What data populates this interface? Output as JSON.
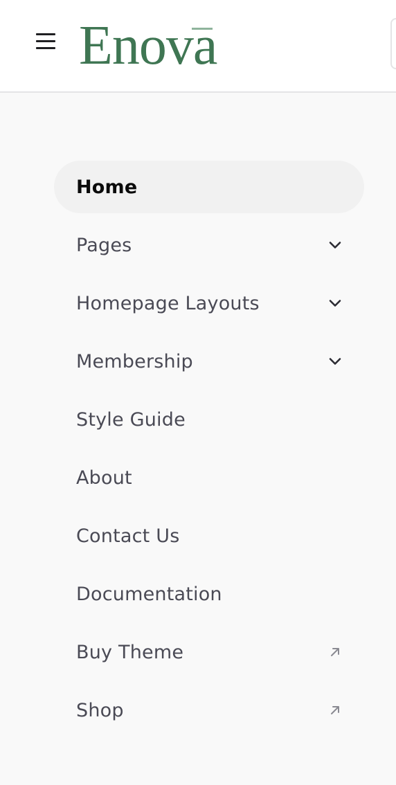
{
  "header": {
    "brand": "Enova",
    "menu_icon": "hamburger-menu-icon"
  },
  "menu": {
    "items": [
      {
        "label": "Home",
        "active": true,
        "trail_icon": ""
      },
      {
        "label": "Pages",
        "active": false,
        "trail_icon": "chevron-down-icon"
      },
      {
        "label": "Homepage Layouts",
        "active": false,
        "trail_icon": "chevron-down-icon"
      },
      {
        "label": "Membership",
        "active": false,
        "trail_icon": "chevron-down-icon"
      },
      {
        "label": "Style Guide",
        "active": false,
        "trail_icon": ""
      },
      {
        "label": "About",
        "active": false,
        "trail_icon": ""
      },
      {
        "label": "Contact Us",
        "active": false,
        "trail_icon": ""
      },
      {
        "label": "Documentation",
        "active": false,
        "trail_icon": ""
      },
      {
        "label": "Buy Theme",
        "active": false,
        "trail_icon": "external-arrow-icon"
      },
      {
        "label": "Shop",
        "active": false,
        "trail_icon": "external-arrow-icon"
      }
    ]
  },
  "colors": {
    "brand": "#3f7653",
    "page_background": "#f9f9f9",
    "active_item_background": "#f1f1f1",
    "menu_text": "#4a4a55"
  }
}
